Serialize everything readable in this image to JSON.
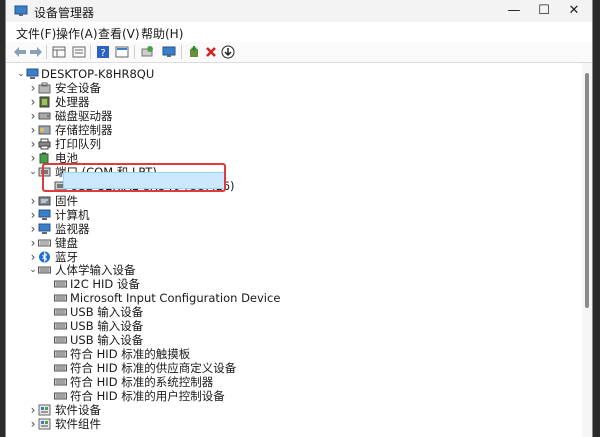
{
  "window": {
    "title": "设备管理器",
    "controls": [
      "—",
      "☐",
      "✕"
    ]
  },
  "menu": [
    "文件(F)",
    "操作(A)",
    "查看(V)",
    "帮助(H)"
  ],
  "toolbar": [
    "back-arrow-icon",
    "forward-arrow-icon",
    "grid-icon",
    "list-icon",
    "help-icon",
    "properties-icon",
    "scan-hardware-icon",
    "monitor-icon",
    "add-driver-icon",
    "uninstall-icon",
    "download-icon"
  ],
  "tree": [
    {
      "label": "DESKTOP-K8HR8QU",
      "level": 0,
      "chev": "v",
      "icon": "computer"
    },
    {
      "label": "安全设备",
      "level": 1,
      "chev": ">",
      "icon": "security"
    },
    {
      "label": "处理器",
      "level": 1,
      "chev": ">",
      "icon": "cpu"
    },
    {
      "label": "磁盘驱动器",
      "level": 1,
      "chev": ">",
      "icon": "disk"
    },
    {
      "label": "存储控制器",
      "level": 1,
      "chev": ">",
      "icon": "storage"
    },
    {
      "label": "打印队列",
      "level": 1,
      "chev": ">",
      "icon": "printer"
    },
    {
      "label": "电池",
      "level": 1,
      "chev": ">",
      "icon": "battery"
    },
    {
      "label": "端口 (COM 和 LPT)",
      "level": 1,
      "chev": "v",
      "icon": "port"
    },
    {
      "label": "USB-SERIAL CH340 (COM16)",
      "level": 2,
      "chev": "",
      "icon": "port",
      "selected": true
    },
    {
      "label": "固件",
      "level": 1,
      "chev": ">",
      "icon": "firmware"
    },
    {
      "label": "计算机",
      "level": 1,
      "chev": ">",
      "icon": "monitor"
    },
    {
      "label": "监视器",
      "level": 1,
      "chev": ">",
      "icon": "monitor"
    },
    {
      "label": "键盘",
      "level": 1,
      "chev": ">",
      "icon": "keyboard"
    },
    {
      "label": "蓝牙",
      "level": 1,
      "chev": ">",
      "icon": "bluetooth"
    },
    {
      "label": "人体学输入设备",
      "level": 1,
      "chev": "v",
      "icon": "hid"
    },
    {
      "label": "I2C HID 设备",
      "level": 2,
      "chev": "",
      "icon": "hid"
    },
    {
      "label": "Microsoft Input Configuration Device",
      "level": 2,
      "chev": "",
      "icon": "hid"
    },
    {
      "label": "USB 输入设备",
      "level": 2,
      "chev": "",
      "icon": "hid"
    },
    {
      "label": "USB 输入设备",
      "level": 2,
      "chev": "",
      "icon": "hid"
    },
    {
      "label": "USB 输入设备",
      "level": 2,
      "chev": "",
      "icon": "hid"
    },
    {
      "label": "符合 HID 标准的触摸板",
      "level": 2,
      "chev": "",
      "icon": "hid"
    },
    {
      "label": "符合 HID 标准的供应商定义设备",
      "level": 2,
      "chev": "",
      "icon": "hid"
    },
    {
      "label": "符合 HID 标准的系统控制器",
      "level": 2,
      "chev": "",
      "icon": "hid"
    },
    {
      "label": "符合 HID 标准的用户控制设备",
      "level": 2,
      "chev": "",
      "icon": "hid"
    },
    {
      "label": "软件设备",
      "level": 1,
      "chev": ">",
      "icon": "software"
    },
    {
      "label": "软件组件",
      "level": 1,
      "chev": ">",
      "icon": "software"
    }
  ],
  "colors": {
    "highlight_box": "#e03a3a",
    "selection": "#cce8ff"
  }
}
